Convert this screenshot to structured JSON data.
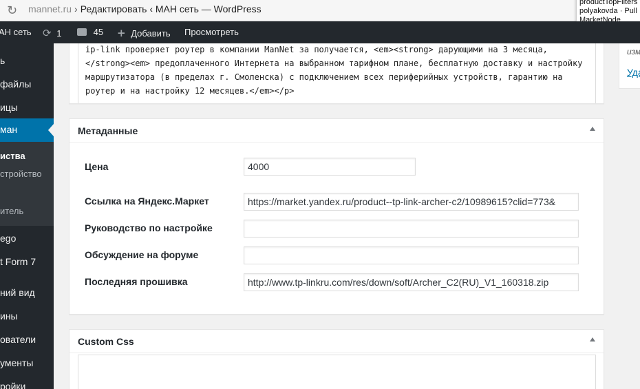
{
  "browser": {
    "domain": "mannet.ru",
    "separator": "›",
    "page_title": "Редактировать ‹ МАН сеть — WordPress",
    "tooltip_lines": [
      "productTopFilters",
      "polyakovda · Pull",
      "MarketNode"
    ]
  },
  "adminbar": {
    "site_name": "АН сеть",
    "updates_count": "1",
    "comments_count": "45",
    "add_label": "Добавить",
    "view_label": "Просмотреть"
  },
  "menu": {
    "items": [
      "ь",
      "файлы",
      "ицы",
      "ман",
      "ego",
      "t Form 7",
      "ний вид",
      "ины",
      "ователи",
      "ументы",
      "ройки"
    ],
    "submenu": [
      "иства",
      "стройство",
      "итель"
    ]
  },
  "editor": {
    "lines": [
      "ip-link проверяет роутер в компании ManNet за получается, <em><strong> дарующими на 3 месяца,",
      "</strong><em> предоплаченного Интернета на выбранном тарифном плане, бесплатную доставку и настройку",
      "маршрутизатора (в пределах г. Смоленска) с подключением всех периферийных устройств, гарантию на",
      "роутер и на настройку 12 месяцев.</em></p>"
    ]
  },
  "metabox": {
    "title": "Метаданные",
    "fields": [
      {
        "label": "Цена",
        "value": ""
      },
      {
        "label": "Ссылка на Яндекс.Маркет",
        "value": ""
      },
      {
        "label": "Руководство по настройке",
        "value": ""
      },
      {
        "label": "Обсуждение на форуме",
        "value": ""
      },
      {
        "label": "Последняя прошивка",
        "value": ""
      }
    ],
    "price": "4000",
    "market_url": "https://market.yandex.ru/product--tp-link-archer-c2/10989615?clid=773&",
    "manual_url": "",
    "forum_url": "",
    "firmware_url": "http://www.tp-linkru.com/res/down/soft/Archer_C2(RU)_V1_160318.zip"
  },
  "custom_css": {
    "title": "Custom Css"
  },
  "sidebar": {
    "note": "изм",
    "link": "Уда"
  }
}
